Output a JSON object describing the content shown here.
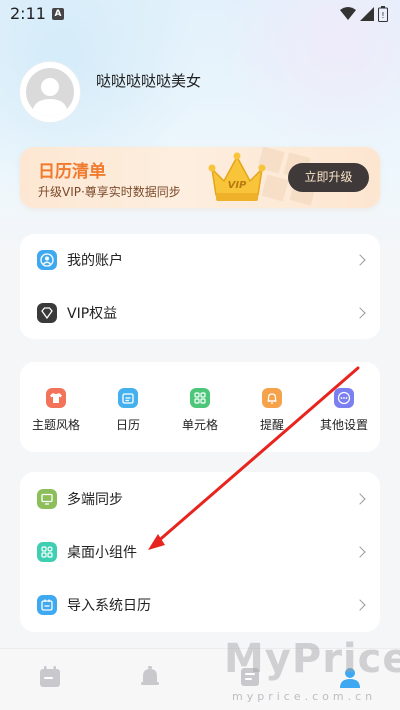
{
  "status_bar": {
    "time": "2:11",
    "notification_badge": "A"
  },
  "profile": {
    "username": "哒哒哒哒哒美女"
  },
  "vip_banner": {
    "title": "日历清单",
    "subtitle": "升级VIP·尊享实时数据同步",
    "crown_text": "VIP",
    "upgrade_label": "立即升级"
  },
  "account_menu": [
    {
      "label": "我的账户",
      "icon": "user-icon",
      "color": "#3ea9f0"
    },
    {
      "label": "VIP权益",
      "icon": "diamond-icon",
      "color": "#3a3a3a"
    }
  ],
  "tools": [
    {
      "label": "主题风格",
      "icon": "shirt-icon",
      "color": "#f2735a"
    },
    {
      "label": "日历",
      "icon": "calendar-icon",
      "color": "#45b0ee"
    },
    {
      "label": "单元格",
      "icon": "grid-icon",
      "color": "#4cc77a"
    },
    {
      "label": "提醒",
      "icon": "bell-icon",
      "color": "#f5a24a"
    },
    {
      "label": "其他设置",
      "icon": "more-icon",
      "color": "#7b7ff0"
    }
  ],
  "more_menu": [
    {
      "label": "多端同步",
      "icon": "monitor-icon",
      "color": "#8cbf5a"
    },
    {
      "label": "桌面小组件",
      "icon": "widget-icon",
      "color": "#3ecfb2"
    },
    {
      "label": "导入系统日历",
      "icon": "calendar-import-icon",
      "color": "#3ea9f0"
    }
  ],
  "bottom_nav": [
    {
      "icon": "calendar-tab-icon",
      "active": false
    },
    {
      "icon": "bell-tab-icon",
      "active": false
    },
    {
      "icon": "list-tab-icon",
      "active": false
    },
    {
      "icon": "profile-tab-icon",
      "active": true
    }
  ],
  "watermark": {
    "text": "MyPrice",
    "sub": "myprice.com.cn"
  },
  "colors": {
    "accent": "#f07a2e",
    "active_tab": "#3ea9f0",
    "annotation": "#e8241f"
  }
}
